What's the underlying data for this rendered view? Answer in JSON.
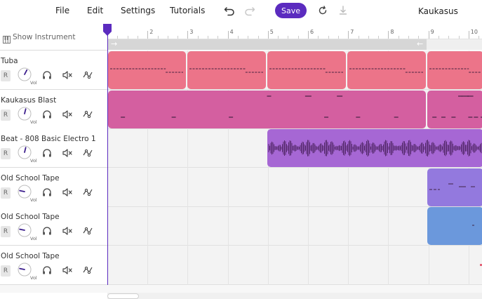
{
  "menu": {
    "file": "File",
    "edit": "Edit",
    "settings": "Settings",
    "tutorials": "Tutorials",
    "save": "Save",
    "project_name": "Kaukasus"
  },
  "show_instrument": "Show Instrument",
  "ruler": {
    "marks": [
      "2",
      "3",
      "4",
      "5",
      "6",
      "7",
      "8",
      "9",
      "10"
    ]
  },
  "tracks": [
    {
      "name": "Tuba",
      "record": "R",
      "vol_label": "Vol",
      "color": "#ec7489",
      "volume": 0.6
    },
    {
      "name": "Kaukasus Blast",
      "record": "R",
      "vol_label": "Vol",
      "color": "#d45fa0",
      "volume": 0.55
    },
    {
      "name": "Beat - 808 Basic Electro 1",
      "record": "R",
      "vol_label": "Vol",
      "color": "#a667d4",
      "volume": 0.55
    },
    {
      "name": "Old School Tape",
      "record": "R",
      "vol_label": "Vol",
      "color": "#9379de",
      "volume": 0.22
    },
    {
      "name": "Old School Tape",
      "record": "R",
      "vol_label": "Vol",
      "color": "#6b98dc",
      "volume": 0.22
    },
    {
      "name": "Old School Tape",
      "record": "R",
      "vol_label": "Vol",
      "color": "#e2566d",
      "volume": 0.22
    }
  ],
  "colors": {
    "accent": "#5b2bbf",
    "loop": "#d6d6d6"
  },
  "icons": {
    "undo": "undo-icon",
    "redo": "redo-icon",
    "reset": "rotate-icon",
    "download": "download-icon",
    "show_instrument": "piano-icon",
    "headphones": "headphones-icon",
    "mute": "speaker-mute-icon",
    "automation": "automation-icon"
  }
}
